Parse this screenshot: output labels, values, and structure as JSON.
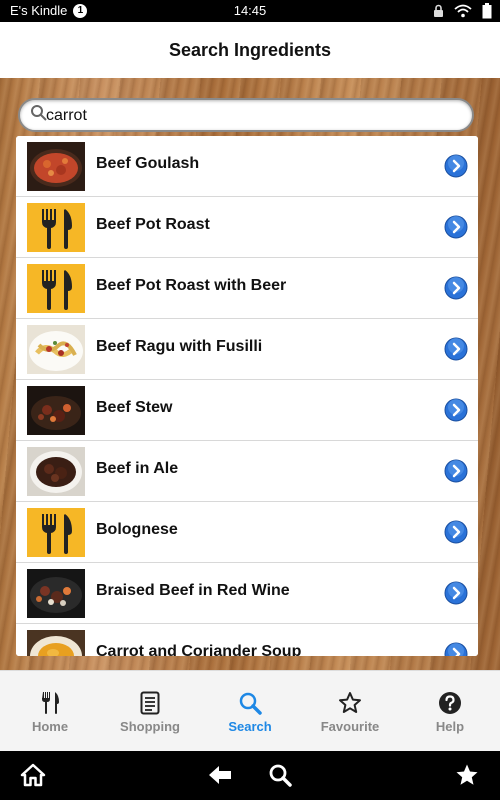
{
  "status_bar": {
    "device_name": "E's Kindle",
    "notification_count": "1",
    "time": "14:45"
  },
  "header": {
    "title": "Search Ingredients"
  },
  "search": {
    "value": "carrot"
  },
  "results": [
    {
      "label": "Beef Goulash",
      "thumb": "photo-stew"
    },
    {
      "label": "Beef Pot Roast",
      "thumb": "fork-knife-icon"
    },
    {
      "label": "Beef Pot Roast with Beer",
      "thumb": "fork-knife-icon"
    },
    {
      "label": "Beef Ragu with Fusilli",
      "thumb": "photo-pasta"
    },
    {
      "label": "Beef Stew",
      "thumb": "photo-pot"
    },
    {
      "label": "Beef in Ale",
      "thumb": "photo-bowl"
    },
    {
      "label": "Bolognese",
      "thumb": "fork-knife-icon"
    },
    {
      "label": "Braised Beef in Red Wine",
      "thumb": "photo-casserole"
    },
    {
      "label": "Carrot and Coriander Soup",
      "thumb": "photo-soup"
    }
  ],
  "tabs": [
    {
      "label": "Home",
      "icon": "fork-knife-icon",
      "active": false
    },
    {
      "label": "Shopping",
      "icon": "list-icon",
      "active": false
    },
    {
      "label": "Search",
      "icon": "search-icon",
      "active": true
    },
    {
      "label": "Favourite",
      "icon": "star-outline-icon",
      "active": false
    },
    {
      "label": "Help",
      "icon": "help-icon",
      "active": false
    }
  ],
  "system_nav": [
    "home-icon",
    "back-icon",
    "search-icon",
    "favorite-icon"
  ],
  "colors": {
    "accent": "#1e88e5",
    "thumb_yellow": "#f6b726",
    "arrow_blue": "#2a72d8"
  }
}
